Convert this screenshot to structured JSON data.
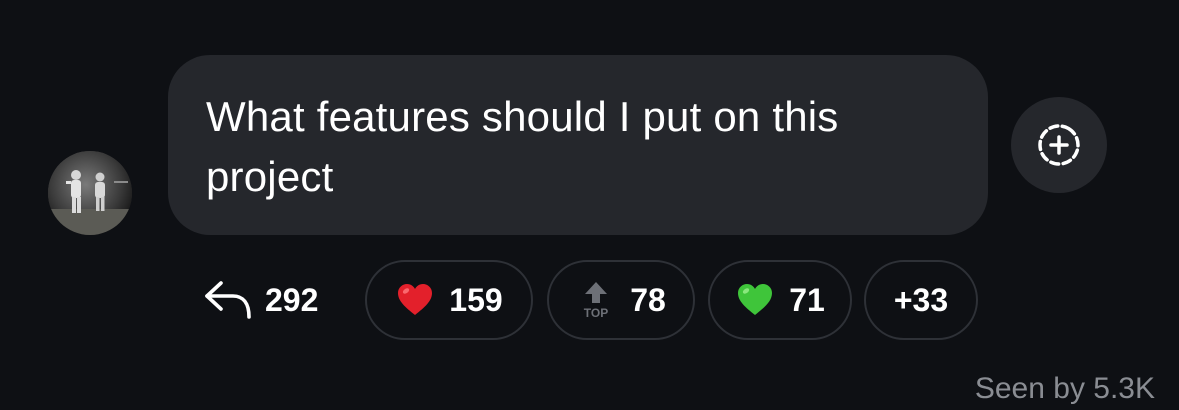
{
  "message": {
    "text": "What features should I put on this project"
  },
  "actions": {
    "add_reaction_icon": "add-reaction-icon"
  },
  "reply": {
    "count": "292",
    "icon": "reply-arrow-icon"
  },
  "reactions": [
    {
      "emoji": "red-heart",
      "count": "159"
    },
    {
      "emoji": "top-arrow",
      "count": "78"
    },
    {
      "emoji": "green-heart",
      "count": "71"
    }
  ],
  "more_reactions": "+33",
  "seen": "Seen by 5.3K",
  "colors": {
    "background": "#0e1014",
    "bubble": "#25272c",
    "chip_border": "#2e3137",
    "seen_text": "#8a8d93",
    "red_heart": "#e3202b",
    "green_heart": "#3fc53a"
  }
}
